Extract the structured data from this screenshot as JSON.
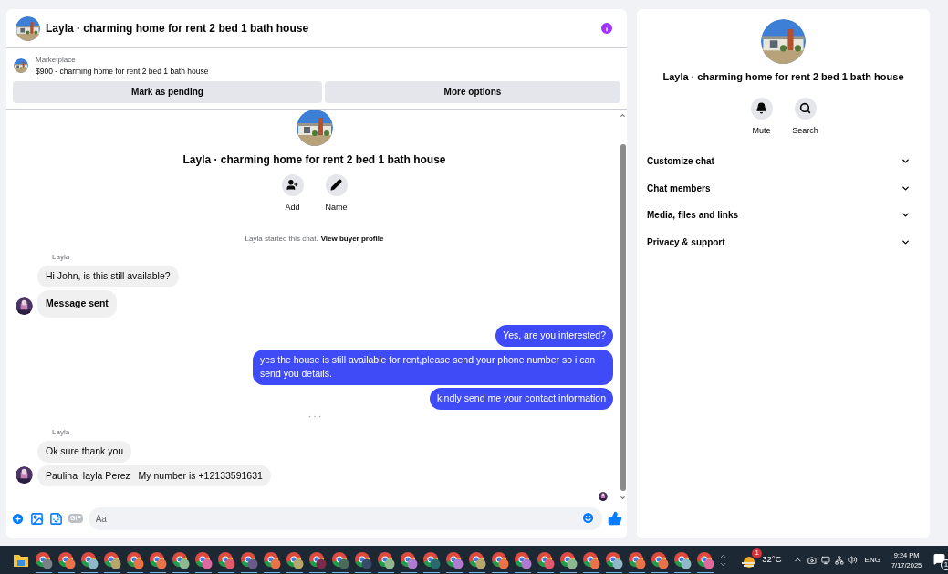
{
  "header": {
    "title": "Layla · charming home for rent 2 bed 1 bath house"
  },
  "listing": {
    "source": "Marketplace",
    "description": "$900 - charming home for rent 2 bed 1 bath house"
  },
  "listing_actions": [
    "Mark as pending",
    "More options"
  ],
  "chat_intro": {
    "title": "Layla · charming home for rent 2 bed 1 bath house",
    "actions": [
      {
        "kind": "add",
        "label": "Add"
      },
      {
        "kind": "name",
        "label": "Name"
      }
    ],
    "notice": "Layla started this chat.",
    "link": "View buyer profile"
  },
  "thread": [
    {
      "kind": "incoming",
      "sender": "Layla",
      "messages": [
        {
          "text": "Hi John, is this still available?",
          "bold": false
        },
        {
          "text": "Message sent",
          "bold": true
        }
      ]
    },
    {
      "kind": "outgoing",
      "messages": [
        {
          "text": "Yes, are you interested?",
          "bold": false
        },
        {
          "text": "yes the house is still available for rent,please send your phone number so i can send you details.",
          "bold": false
        },
        {
          "text": "kindly send me your contact information",
          "bold": false
        }
      ]
    },
    {
      "kind": "separator"
    },
    {
      "kind": "incoming",
      "sender": "Layla",
      "messages": [
        {
          "text": "Ok sure thank you",
          "bold": false
        },
        {
          "text": "Paulina  layla Perez   My number is +12133591631",
          "bold": false
        }
      ]
    }
  ],
  "composer": {
    "gif_label": "GIF",
    "placeholder": "Aa"
  },
  "details": {
    "title": "Layla · charming home for rent 2 bed 1 bath house",
    "actions": [
      {
        "kind": "mute",
        "label": "Mute"
      },
      {
        "kind": "search",
        "label": "Search"
      }
    ],
    "sections": [
      {
        "label": "Customize chat",
        "expanded": false
      },
      {
        "label": "Chat members",
        "expanded": false
      },
      {
        "label": "Media, files and links",
        "expanded": false
      },
      {
        "label": "Privacy & support",
        "expanded": false
      }
    ]
  },
  "taskbar": {
    "apps": [
      {
        "kind": "folder"
      },
      {
        "kind": "browser",
        "color": "#7b7f86"
      },
      {
        "kind": "browser",
        "color": "#e8734a"
      },
      {
        "kind": "browser",
        "color": "#8fb8c8"
      },
      {
        "kind": "browser",
        "color": "#b5a66b"
      },
      {
        "kind": "browser",
        "color": "#e8734a"
      },
      {
        "kind": "browser",
        "color": "#e8734a"
      },
      {
        "kind": "browser",
        "color": "#8fb88f"
      },
      {
        "kind": "browser",
        "color": "#e06aa0"
      },
      {
        "kind": "browser",
        "color": "#e05a6a"
      },
      {
        "kind": "browser",
        "color": "#6a5a8a"
      },
      {
        "kind": "browser",
        "color": "#e8734a"
      },
      {
        "kind": "browser",
        "color": "#b5a66b"
      },
      {
        "kind": "browser",
        "color": "#7a2a4a"
      },
      {
        "kind": "browser",
        "color": "#4a6a5a"
      },
      {
        "kind": "browser",
        "color": "#3a4a6a"
      },
      {
        "kind": "browser",
        "color": "#8fb88f"
      },
      {
        "kind": "browser",
        "color": "#b07ad0"
      },
      {
        "kind": "browser",
        "color": "#2a6a6a"
      },
      {
        "kind": "browser",
        "color": "#b07ad0"
      },
      {
        "kind": "browser",
        "color": "#b5a66b"
      },
      {
        "kind": "browser",
        "color": "#e8734a"
      },
      {
        "kind": "browser",
        "color": "#b07ad0"
      },
      {
        "kind": "browser",
        "color": "#e05a6a"
      },
      {
        "kind": "browser",
        "color": "#8fb88f"
      },
      {
        "kind": "browser",
        "color": "#e8734a"
      },
      {
        "kind": "browser",
        "color": "#8fb8c8"
      },
      {
        "kind": "browser",
        "color": "#e8734a"
      },
      {
        "kind": "browser",
        "color": "#e8734a"
      },
      {
        "kind": "browser",
        "color": "#8fb8c8"
      },
      {
        "kind": "browser",
        "color": "#e06aa0"
      }
    ],
    "weather_badge": "1",
    "temperature": "32°C",
    "language": "ENG",
    "time": "9:24 PM",
    "date": "7/17/2025",
    "notification_badge": "1"
  }
}
